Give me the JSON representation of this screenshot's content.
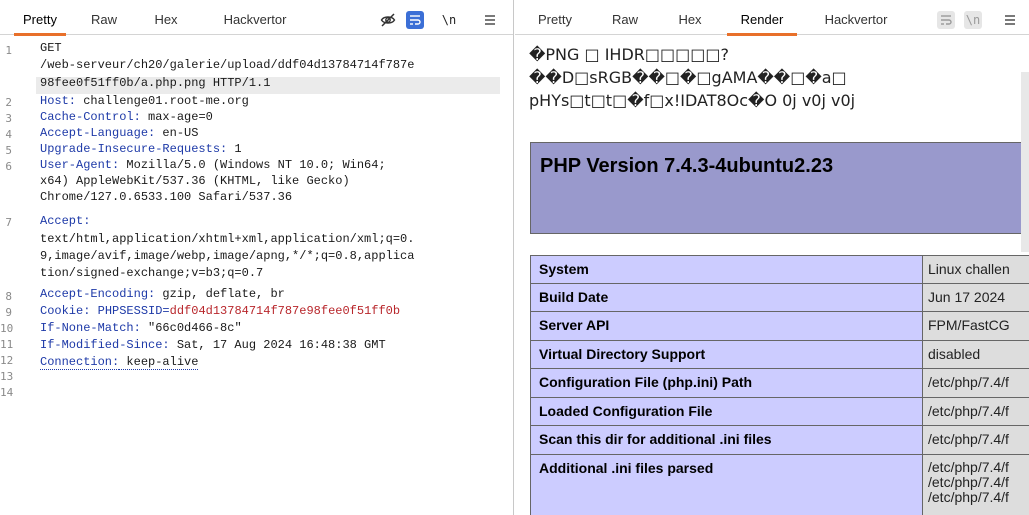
{
  "left": {
    "tabs": [
      "Pretty",
      "Raw",
      "Hex",
      "Hackvertor"
    ],
    "active_tab": "Pretty",
    "icons": [
      "eye-off-icon",
      "word-wrap-icon",
      "newline-icon",
      "menu-icon"
    ],
    "newline_label": "\\n",
    "line_numbers": [
      "1",
      "2",
      "3",
      "4",
      "5",
      "6",
      "7",
      "8",
      "9",
      "10",
      "11",
      "12",
      "13",
      "14"
    ],
    "lines": {
      "l1a": "GET",
      "l1b": "/web-serveur/ch20/galerie/upload/ddf04d13784714f787e",
      "l1c": "98fee0f51ff0b/a.php.png HTTP/1.1",
      "host_k": "Host:",
      "host_v": " challenge01.root-me.org",
      "cache_k": "Cache-Control:",
      "cache_v": " max-age=0",
      "lang_k": "Accept-Language:",
      "lang_v": " en-US",
      "uir_k": "Upgrade-Insecure-Requests:",
      "uir_v": " 1",
      "ua_k": "User-Agent:",
      "ua_v1": " Mozilla/5.0 (Windows NT 10.0; Win64;",
      "ua_v2": "x64) AppleWebKit/537.36 (KHTML, like Gecko)",
      "ua_v3": "Chrome/127.0.6533.100 Safari/537.36",
      "acc_k": "Accept:",
      "acc_v1": "text/html,application/xhtml+xml,application/xml;q=0.",
      "acc_v2": "9,image/avif,image/webp,image/apng,*/*;q=0.8,applica",
      "acc_v3": "tion/signed-exchange;v=b3;q=0.7",
      "enc_k": "Accept-Encoding:",
      "enc_v": " gzip, deflate, br",
      "cookie_k": "Cookie:",
      "cookie_name": " PHPSESSID=",
      "cookie_val": "ddf04d13784714f787e98fee0f51ff0b",
      "inm_k": "If-None-Match:",
      "inm_v": " \"66c0d466-8c\"",
      "ims_k": "If-Modified-Since:",
      "ims_v": " Sat, 17 Aug 2024 16:48:38 GMT",
      "conn_k": "Connection:",
      "conn_v": " keep-alive"
    }
  },
  "right": {
    "tabs": [
      "Pretty",
      "Raw",
      "Hex",
      "Render",
      "Hackvertor"
    ],
    "active_tab": "Render",
    "icons": [
      "word-wrap-icon",
      "newline-icon",
      "menu-icon"
    ],
    "newline_label": "\\n",
    "garble": [
      "�PNG □ IHDR□□□□□?",
      "��D□sRGB��□�□gAMA��□�a□",
      "pHYs□t□t□�f□x!IDAT8Oc�O 0j v0j v0j"
    ],
    "php_title": "PHP Version 7.4.3-4ubuntu2.23",
    "php_rows": [
      {
        "k": "System",
        "v": [
          "Linux challen"
        ]
      },
      {
        "k": "Build Date",
        "v": [
          "Jun 17 2024"
        ]
      },
      {
        "k": "Server API",
        "v": [
          "FPM/FastCG"
        ]
      },
      {
        "k": "Virtual Directory Support",
        "v": [
          "disabled"
        ]
      },
      {
        "k": "Configuration File (php.ini) Path",
        "v": [
          "/etc/php/7.4/f"
        ]
      },
      {
        "k": "Loaded Configuration File",
        "v": [
          "/etc/php/7.4/f"
        ]
      },
      {
        "k": "Scan this dir for additional .ini files",
        "v": [
          "/etc/php/7.4/f"
        ]
      },
      {
        "k": "Additional .ini files parsed",
        "v": [
          "/etc/php/7.4/f",
          "/etc/php/7.4/f",
          "/etc/php/7.4/f"
        ]
      }
    ]
  },
  "colors": {
    "accent": "#e8702a",
    "header_name": "#1e3aa8",
    "cookie_value": "#b8262b",
    "php_header_bg": "#9999cc",
    "php_key_bg": "#ccccff",
    "php_val_bg": "#dddddd"
  }
}
